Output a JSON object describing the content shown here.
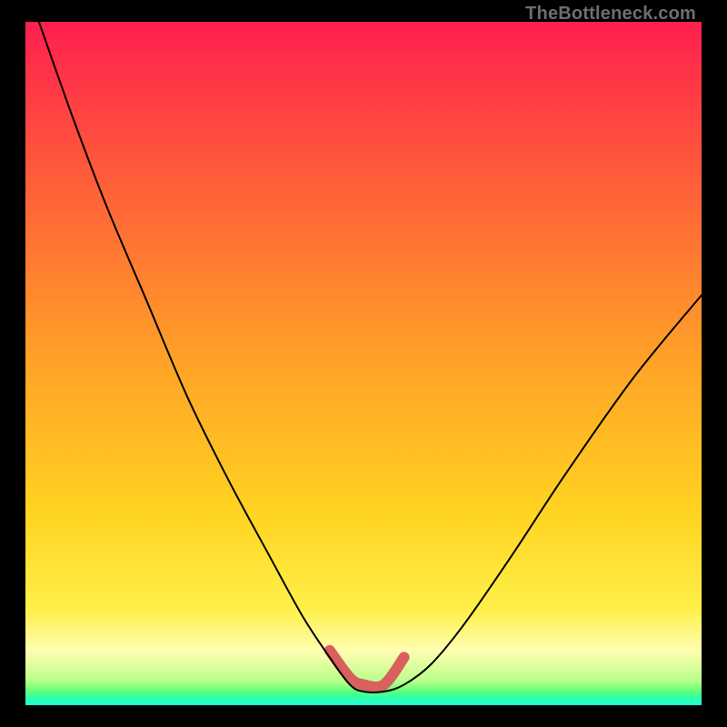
{
  "watermark": "TheBottleneck.com",
  "colors": {
    "top": "#ff1f4f",
    "upper": "#ff5a3a",
    "mid": "#ffa327",
    "low": "#ffd421",
    "pale": "#fff04a",
    "pale2": "#fffdb0",
    "green1": "#b8ff8a",
    "green2": "#5dff7a",
    "green3": "#2dffb0",
    "green4": "#1fffd6",
    "highlight": "#d9605d"
  },
  "chart_data": {
    "type": "line",
    "title": "",
    "xlabel": "",
    "ylabel": "",
    "xlim": [
      0,
      100
    ],
    "ylim": [
      0,
      100
    ],
    "series": [
      {
        "name": "bottleneck-curve",
        "x": [
          2,
          7,
          12,
          18,
          24,
          30,
          36,
          41,
          45,
          48,
          50,
          53,
          56,
          60,
          65,
          72,
          80,
          90,
          100
        ],
        "values": [
          100,
          86,
          73,
          59,
          45,
          33,
          22,
          13,
          7,
          3,
          2,
          2,
          3,
          6,
          12,
          22,
          34,
          48,
          60
        ]
      },
      {
        "name": "highlight-region",
        "x": [
          45,
          48,
          50,
          53,
          56
        ],
        "values": [
          8,
          4,
          3,
          3,
          7
        ]
      }
    ],
    "annotations": []
  }
}
